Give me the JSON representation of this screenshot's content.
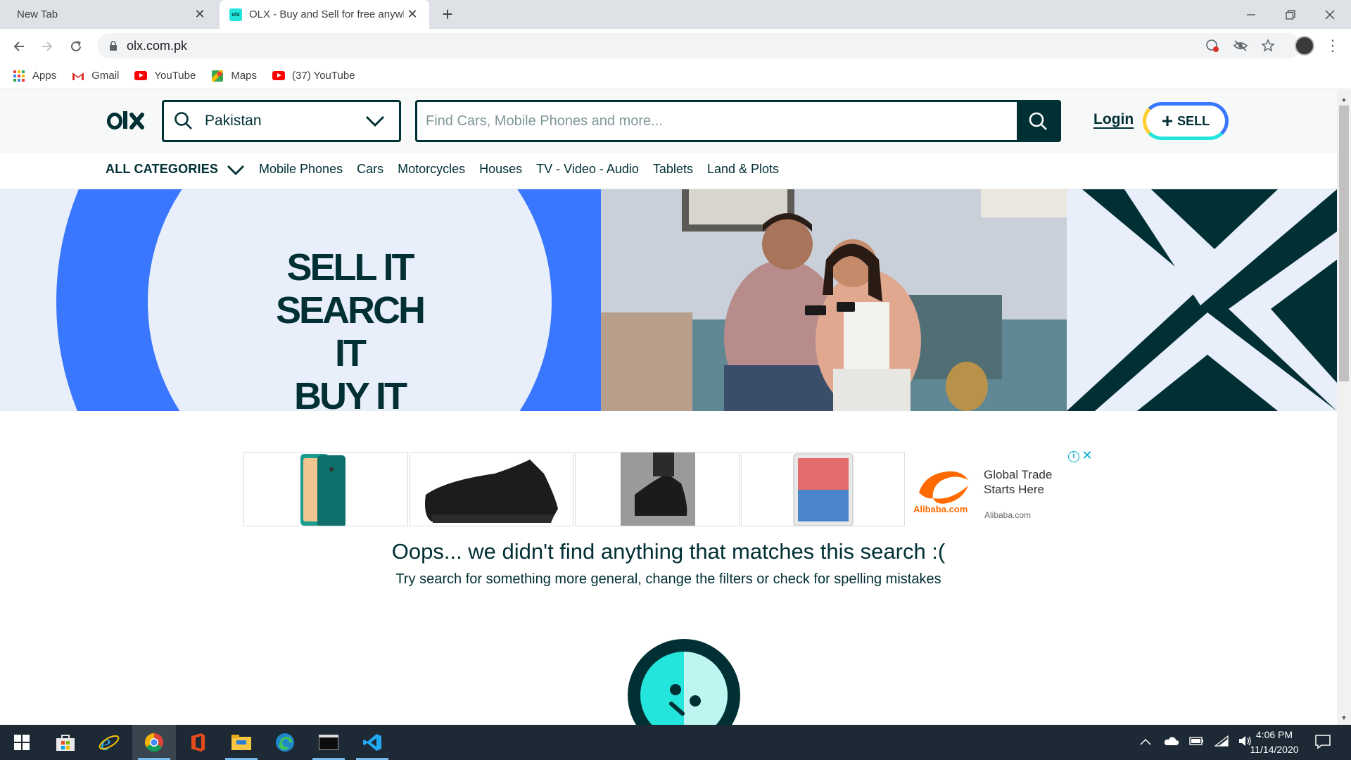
{
  "browser": {
    "tabs": [
      {
        "title": "New Tab",
        "active": false
      },
      {
        "title": "OLX - Buy and Sell for free anywh",
        "active": true
      }
    ],
    "new_tab_icon": "plus-icon",
    "address_bar": {
      "url": "olx.com.pk"
    },
    "bookmarks": [
      {
        "label": "Apps",
        "icon": "apps-grid-icon"
      },
      {
        "label": "Gmail",
        "icon": "gmail-icon"
      },
      {
        "label": "YouTube",
        "icon": "youtube-icon"
      },
      {
        "label": "Maps",
        "icon": "maps-icon"
      },
      {
        "label": "(37) YouTube",
        "icon": "youtube-icon"
      }
    ]
  },
  "header": {
    "location": {
      "value": "Pakistan"
    },
    "search": {
      "placeholder": "Find Cars, Mobile Phones and more..."
    },
    "login_label": "Login",
    "sell_label": "SELL",
    "colors": {
      "primary": "#002f34",
      "accent_teal": "#23e5db",
      "accent_blue": "#3a77ff",
      "accent_yellow": "#ffce32"
    }
  },
  "categories": {
    "all_label": "ALL CATEGORIES",
    "items": [
      "Mobile Phones",
      "Cars",
      "Motorcycles",
      "Houses",
      "TV - Video - Audio",
      "Tablets",
      "Land & Plots"
    ]
  },
  "banner": {
    "slogan_lines": [
      "SELL IT",
      "SEARCH IT",
      "BUY IT"
    ]
  },
  "ad": {
    "headline_line1": "Global Trade",
    "headline_line2": "Starts Here",
    "domain": "Alibaba.com",
    "brand_text": "Alibaba.com"
  },
  "empty_state": {
    "title": "Oops... we didn't find anything that matches this search :(",
    "subtitle": "Try search for something more general, change the filters or check for spelling mistakes"
  },
  "taskbar": {
    "apps": [
      "start-icon",
      "store-icon",
      "ie-icon",
      "chrome-icon",
      "office-icon",
      "file-explorer-icon",
      "edge-icon",
      "terminal-icon",
      "vscode-icon"
    ],
    "time": "4:06 PM",
    "date": "11/14/2020"
  }
}
